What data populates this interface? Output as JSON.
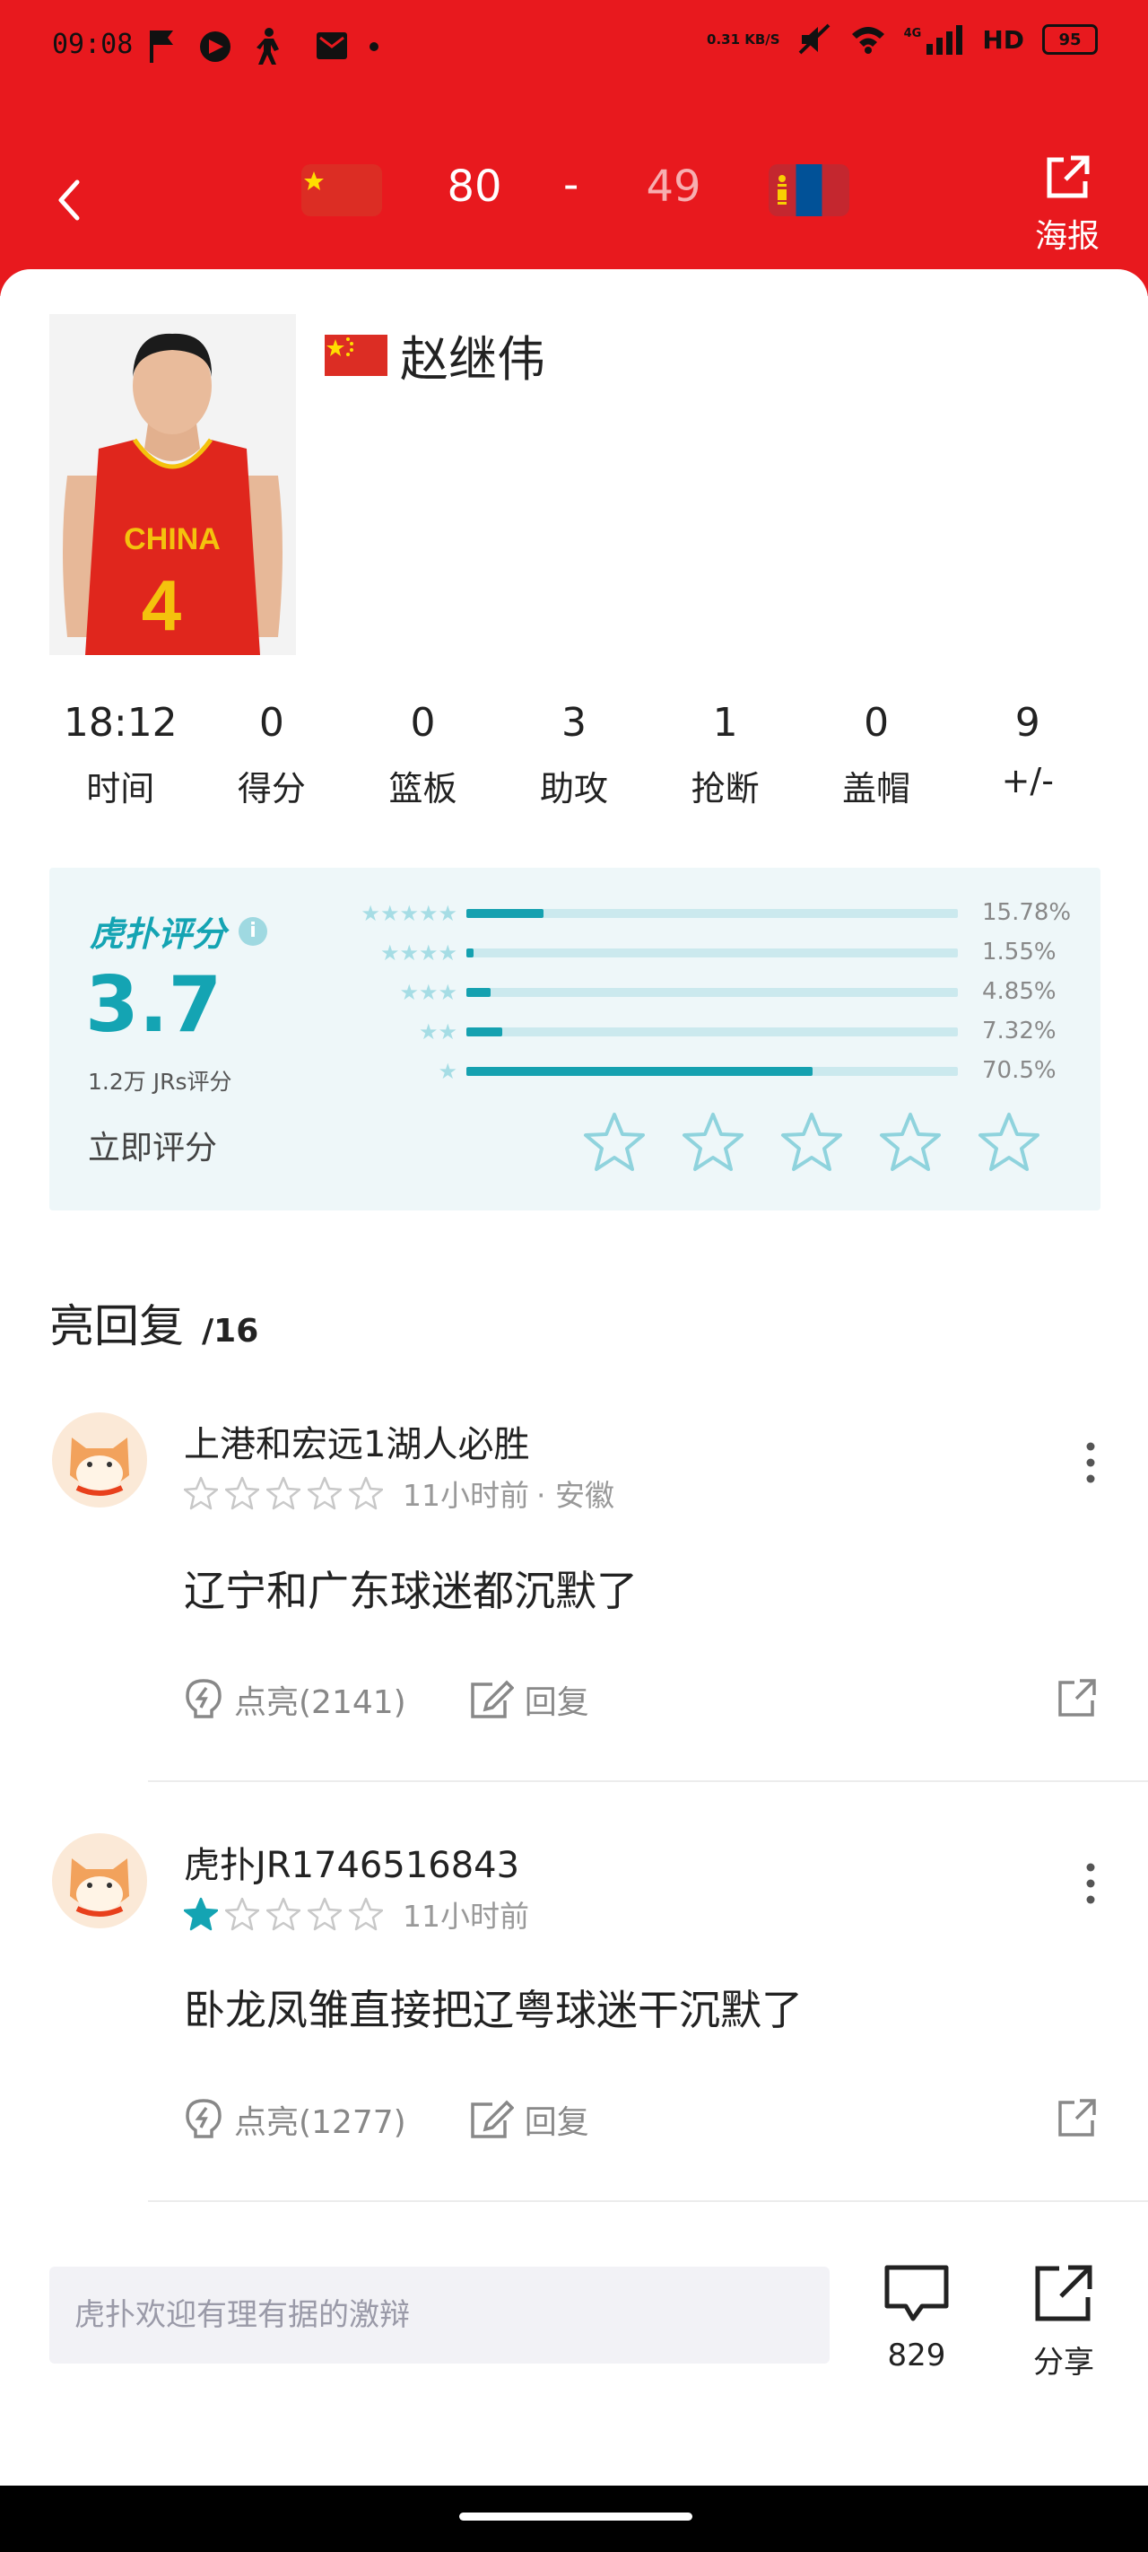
{
  "status_bar": {
    "time": "09:08",
    "net_speed": "0.31 KB/S",
    "network": "4G",
    "hd": "HD",
    "battery": "95"
  },
  "header": {
    "home_score": "80",
    "dash": "-",
    "away_score": "49",
    "poster_label": "海报",
    "colors": {
      "background": "#e8191e"
    }
  },
  "player": {
    "name": "赵继伟",
    "jersey_text": "CHINA",
    "jersey_number": "4"
  },
  "stats": [
    {
      "value": "18:12",
      "label": "时间"
    },
    {
      "value": "0",
      "label": "得分"
    },
    {
      "value": "0",
      "label": "篮板"
    },
    {
      "value": "3",
      "label": "助攻"
    },
    {
      "value": "1",
      "label": "抢断"
    },
    {
      "value": "0",
      "label": "盖帽"
    },
    {
      "value": "9",
      "label": "+/-"
    }
  ],
  "rating": {
    "brand": "虎扑评分",
    "score": "3.7",
    "count_text": "1.2万 JRs评分",
    "rate_now": "立即评分",
    "accent": "#14a4b3",
    "distribution": [
      {
        "stars": 5,
        "percent_text": "15.78%",
        "fraction": 0.1578
      },
      {
        "stars": 4,
        "percent_text": "1.55%",
        "fraction": 0.0155
      },
      {
        "stars": 3,
        "percent_text": "4.85%",
        "fraction": 0.0485
      },
      {
        "stars": 2,
        "percent_text": "7.32%",
        "fraction": 0.0732
      },
      {
        "stars": 1,
        "percent_text": "70.5%",
        "fraction": 0.705
      }
    ]
  },
  "replies": {
    "title": "亮回复",
    "count": "/16",
    "items": [
      {
        "user": "上港和宏远1湖人必胜",
        "rating_stars": 0,
        "time": "11小时前",
        "location": "· 安徽",
        "text": "辽宁和广东球迷都沉默了",
        "like_label": "点亮(2141)",
        "reply_label": "回复"
      },
      {
        "user": "虎扑JR1746516843",
        "rating_stars": 1,
        "time": "11小时前",
        "location": "",
        "text": "卧龙凤雏直接把辽粤球迷干沉默了",
        "like_label": "点亮(1277)",
        "reply_label": "回复"
      }
    ]
  },
  "bottom_bar": {
    "input_placeholder": "虎扑欢迎有理有据的激辩",
    "comment_count": "829",
    "share_label": "分享"
  }
}
